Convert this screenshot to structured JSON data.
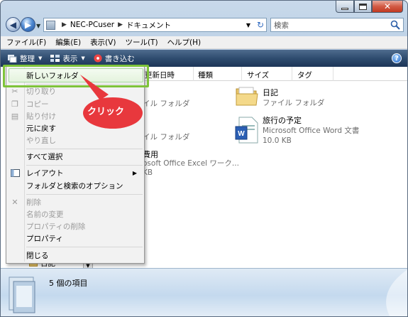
{
  "addressbar": {
    "crumb1": "NEC-PCuser",
    "crumb2": "ドキュメント"
  },
  "search": {
    "placeholder": "検索"
  },
  "menubar": {
    "items": [
      "ファイル(F)",
      "編集(E)",
      "表示(V)",
      "ツール(T)",
      "ヘルプ(H)"
    ]
  },
  "toolbar": {
    "organize": "整理",
    "views": "表示",
    "burn": "書き込む"
  },
  "columns": {
    "date": "更新日時",
    "type": "種類",
    "size": "サイズ",
    "tags": "タグ"
  },
  "files": [
    {
      "name": "日記",
      "type": "ファイル フォルダ"
    },
    {
      "name": "旅行の予定",
      "type": "Microsoft Office Word 文書",
      "size": "10.0 KB"
    }
  ],
  "partial": {
    "r1": "イル フォルダ",
    "r2": "イル フォルダ",
    "r3name": "費用",
    "r3type": "osoft Office Excel ワーク...",
    "r3size": "KB",
    "left_item": "日記"
  },
  "context_menu": {
    "new_folder": "新しいフォルダ",
    "cut": "切り取り",
    "copy": "コピー",
    "paste": "貼り付け",
    "undo": "元に戻す",
    "redo": "やり直し",
    "select_all": "すべて選択",
    "layout": "レイアウト",
    "folder_options": "フォルダと検索のオプション",
    "delete": "削除",
    "rename": "名前の変更",
    "remove_props": "プロパティの削除",
    "properties": "プロパティ",
    "close": "閉じる"
  },
  "callout": {
    "text": "クリック",
    "color": "#e8383d"
  },
  "details": {
    "count": "5 個の項目"
  },
  "colors": {
    "highlight_border": "#7ec33a",
    "toolbar": "#2f4c6f"
  }
}
